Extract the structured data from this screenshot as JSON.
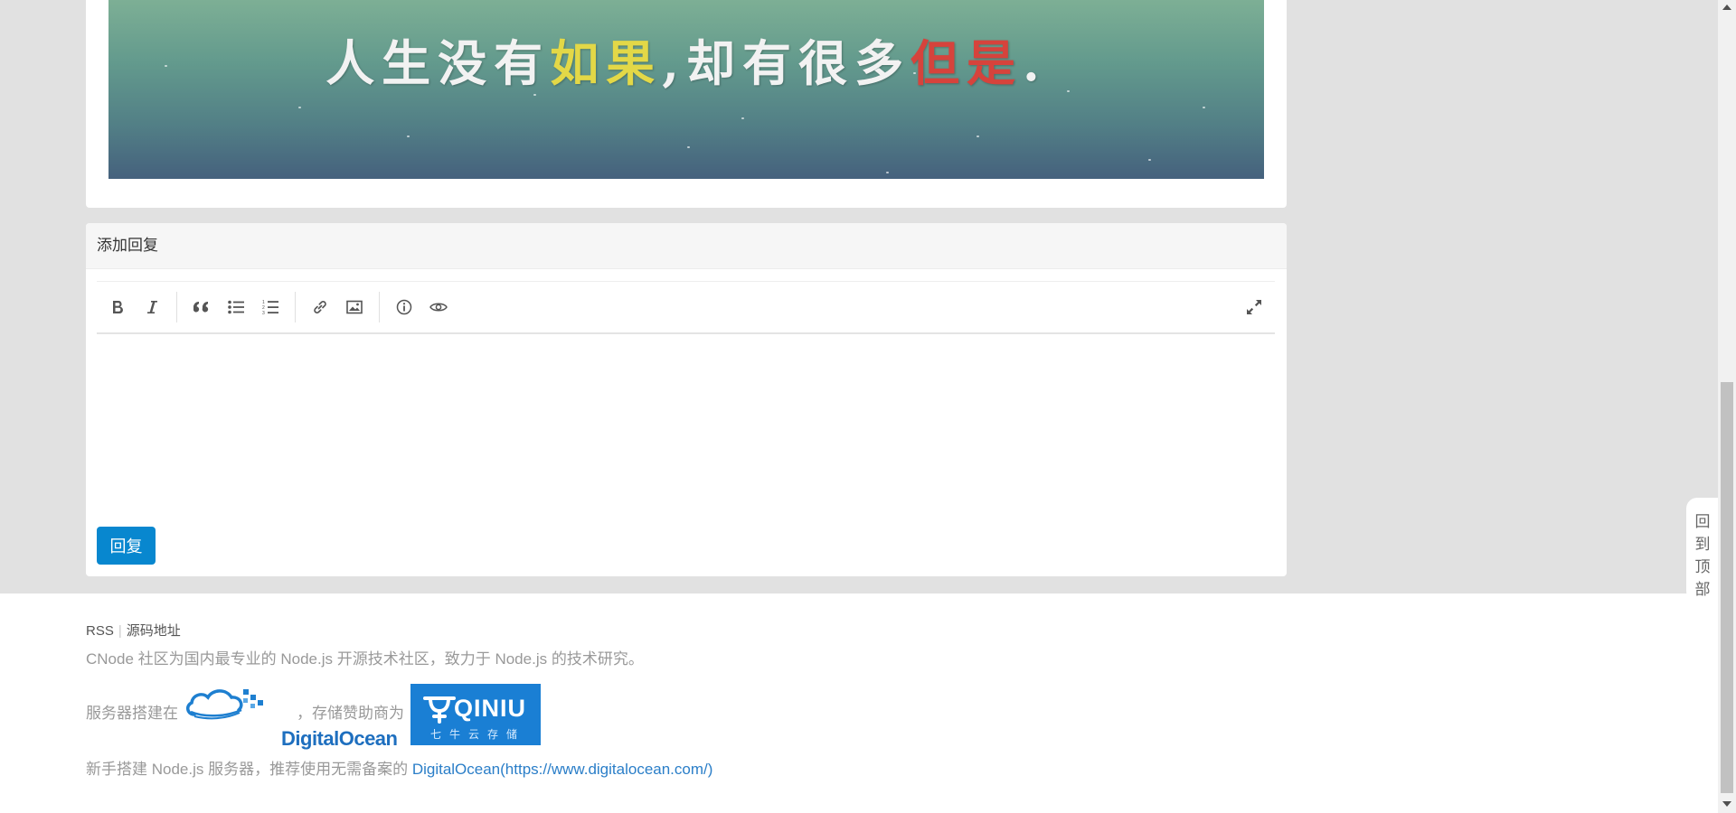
{
  "banner": {
    "text_part1": "人生没有",
    "text_hl1": "如果",
    "text_part2": ",却有很多",
    "text_hl2": "但是",
    "text_end": "."
  },
  "reply": {
    "header": "添加回复",
    "toolbar": [
      "bold-icon",
      "italic-icon",
      "quote-icon",
      "unordered-list-icon",
      "ordered-list-icon",
      "link-icon",
      "image-icon",
      "info-icon",
      "preview-eye-icon",
      "fullscreen-icon"
    ],
    "button_label": "回复"
  },
  "footer": {
    "link_rss": "RSS",
    "separator": "|",
    "link_source": "源码地址",
    "description": "CNode 社区为国内最专业的 Node.js 开源技术社区，致力于 Node.js 的技术研究。",
    "host_label": "服务器搭建在",
    "host_logo_text": "DigitalOcean",
    "sponsor_label": "，存储赞助商为",
    "sponsor_logo_brand": "QINIU",
    "sponsor_logo_sub": "七牛云存储",
    "tip_text": "新手搭建 Node.js 服务器，推荐使用无需备案的 ",
    "tip_link": "DigitalOcean(https://www.digitalocean.com/)"
  },
  "back_to_top": [
    "回",
    "到",
    "顶",
    "部"
  ],
  "colors": {
    "accent": "#0887cf",
    "link": "#2a7ec8",
    "banner_yellow": "#e3d847",
    "banner_red": "#d6433c"
  }
}
